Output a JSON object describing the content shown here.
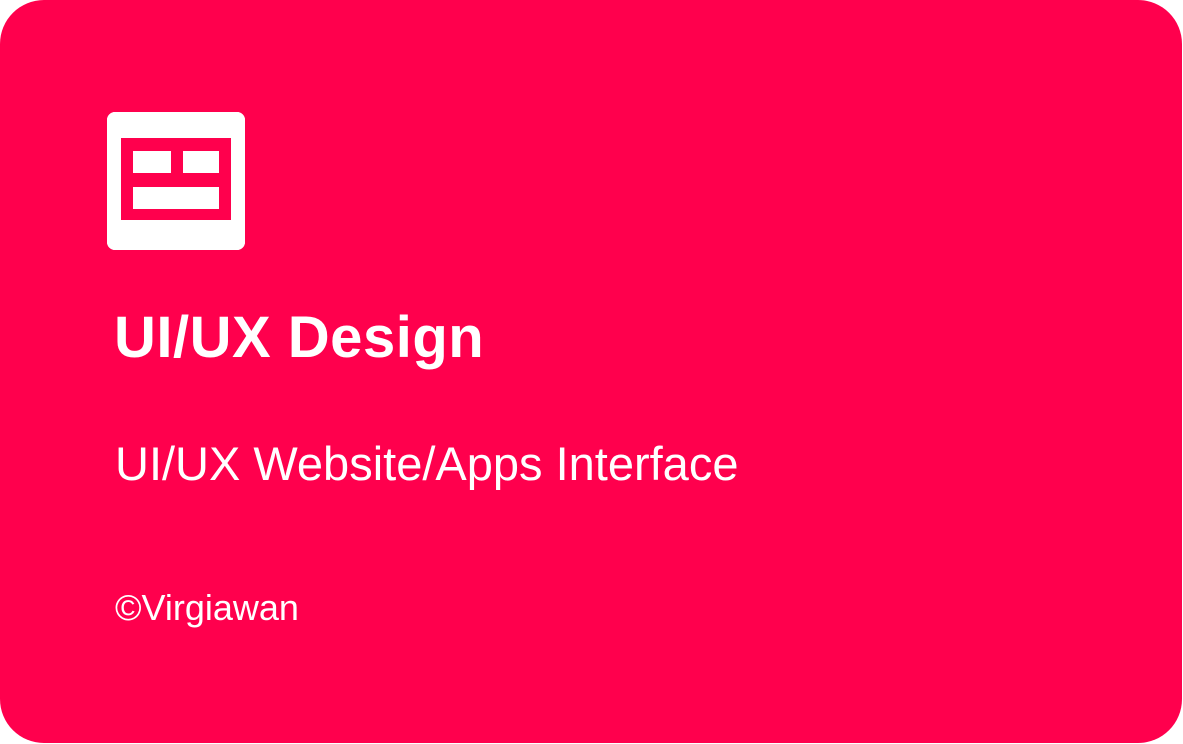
{
  "card": {
    "icon": "layout-grid-icon",
    "title": "UI/UX Design",
    "subtitle": "UI/UX Website/Apps Interface",
    "credit": "©Virgiawan"
  },
  "colors": {
    "background": "#FF004D",
    "foreground": "#FFFFFF"
  }
}
